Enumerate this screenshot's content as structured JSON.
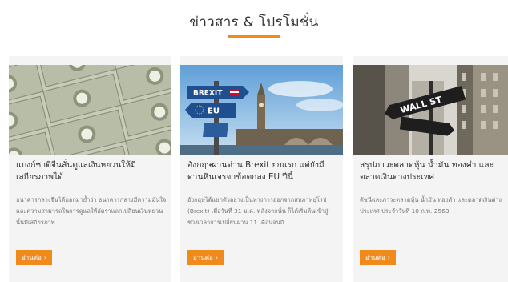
{
  "section": {
    "title": "ข่าวสาร & โปรโมชั่น",
    "accent_color": "#f08a1c"
  },
  "articles": [
    {
      "title": "แบงก์ชาติจีนลั่นดูแลเงินหยวนให้มีเสถียรภาพได้",
      "excerpt": "ธนาคารกลางจีนได้ออกมาย้ำว่า ธนาคารกลางมีความมั่นใจและความสามารถในการดูแลให้อัตราแลกเปลี่ยนเงินหยวนนั้นมีเสถียรภาพ",
      "read_more": "อ่านต่อ",
      "read_more_icon": "chevron-right-icon"
    },
    {
      "title": "อังกฤษผ่านด่าน Brexit ยกแรก แต่ยังมีด่านหินเจรจาข้อตกลง EU ปีนี้",
      "excerpt": "อังกฤษได้แยกตัวอย่างเป็นทางการออกจากสหภาพยุโรป (Brexit) เมื่อวันที่ 31 ม.ค. หลังจากนั้น ก็ได้เริ่มต้นเข้าสู่ช่วงเวลาการเปลี่ยนผ่าน 11 เดือนจนถึ...",
      "read_more": "อ่านต่อ",
      "read_more_icon": "chevron-right-icon",
      "image_text": {
        "sign1": "BREXIT",
        "sign2": "EU"
      }
    },
    {
      "title": "สรุปภาวะตลาดหุ้น น้ำมัน ทองคำ และตลาดเงินต่างประเทศ",
      "excerpt": "ดัชนีและภาวะตลาดหุ้น น้ำมัน ทองคำ และตลาดเงินต่างประเทศ ประจำวันที่ 10 ก.พ. 2563",
      "read_more": "อ่านต่อ",
      "read_more_icon": "chevron-right-icon",
      "image_text": {
        "sign": "WALL ST"
      }
    }
  ]
}
